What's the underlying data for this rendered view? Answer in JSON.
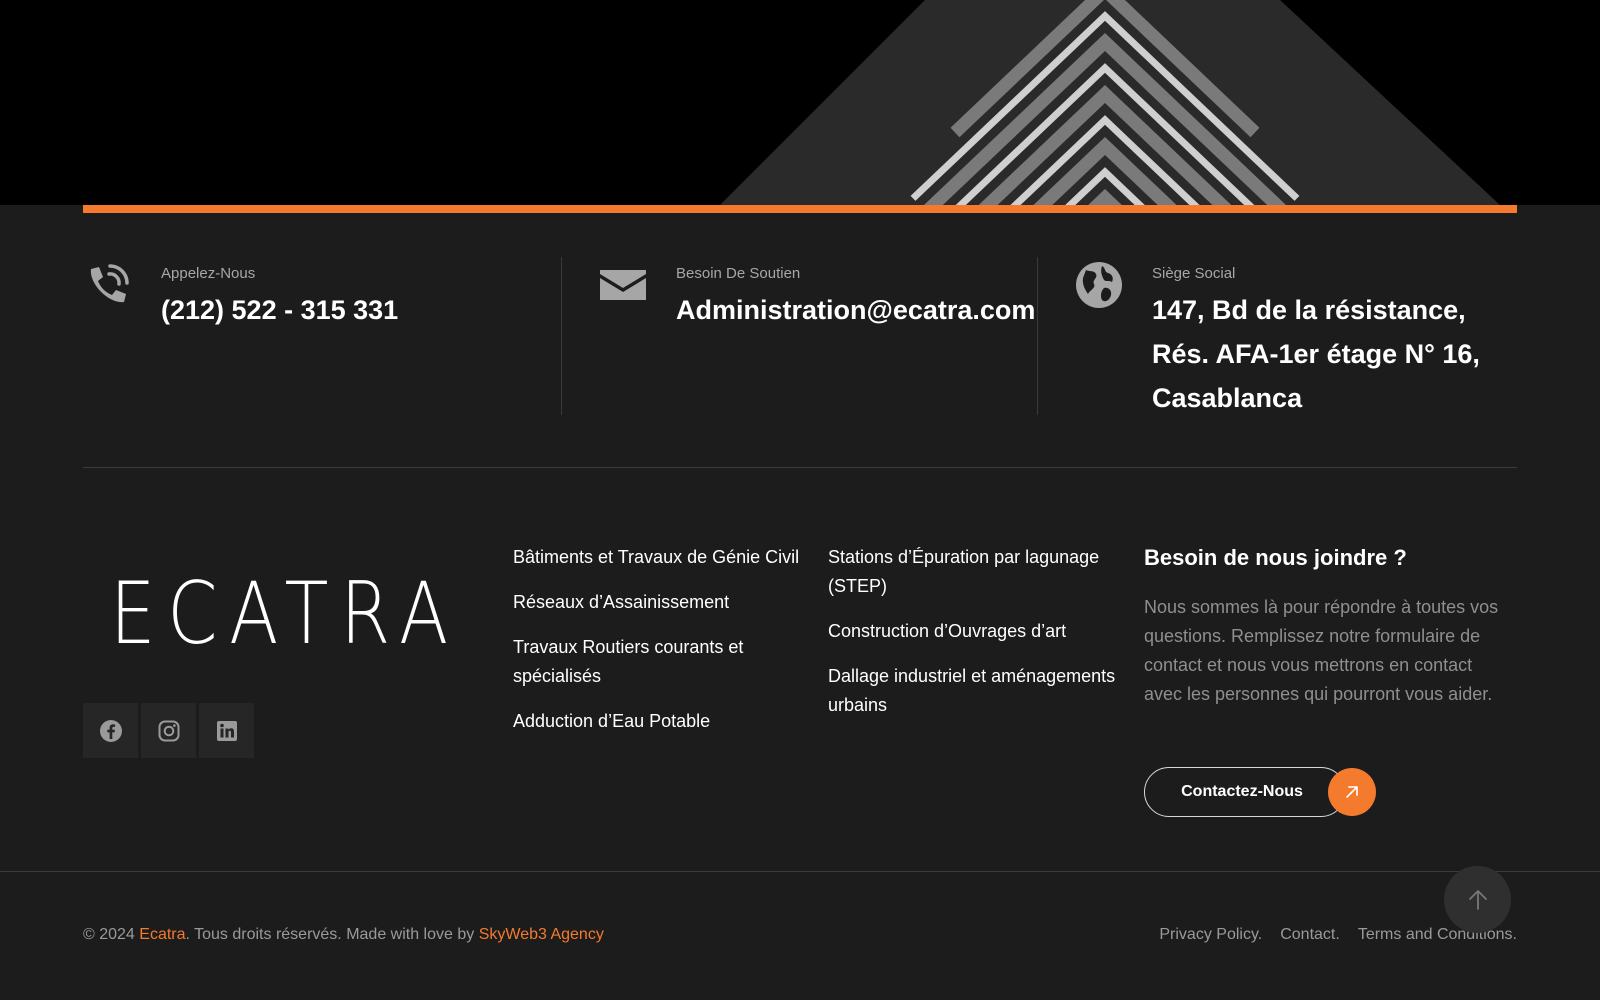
{
  "brand": {
    "accent": "#f47a2e",
    "background": "#1c1c1c"
  },
  "contacts": [
    {
      "icon": "phone-icon",
      "label": "Appelez-Nous",
      "value": "(212) 522 - 315 331"
    },
    {
      "icon": "envelope-icon",
      "label": "Besoin De Soutien",
      "value": "Administration@ecatra.com"
    },
    {
      "icon": "globe-icon",
      "label": "Siège Social",
      "lines": [
        "147, Bd de la résistance,",
        "Rés. AFA-1er étage N° 16,",
        "Casablanca"
      ]
    }
  ],
  "logo": {
    "text": "ECATRA"
  },
  "socials": [
    "facebook-icon",
    "instagram-icon",
    "linkedin-icon"
  ],
  "services_col1": [
    "Bâtiments et Travaux de Génie Civil",
    "Réseaux d’Assainissement",
    "Travaux Routiers courants et spécialisés",
    "Adduction d’Eau Potable"
  ],
  "services_col2": [
    "Stations d’Épuration par lagunage (STEP)",
    "Construction d’Ouvrages d’art",
    "Dallage industriel et aménagements urbains"
  ],
  "join": {
    "title": "Besoin de nous joindre ?",
    "text": "Nous sommes là pour répondre à toutes vos questions. Remplissez notre formulaire de contact et nous vous mettrons en contact avec les personnes qui pourront vous aider.",
    "cta": "Contactez-Nous"
  },
  "footer": {
    "copy_prefix": "© 2024 ",
    "brand_link": "Ecatra",
    "copy_middle": ". Tous droits réservés. Made with love by ",
    "agency_link": "SkyWeb3 Agency",
    "legal": [
      "Privacy Policy.",
      "Contact.",
      "Terms and Conditions."
    ]
  }
}
